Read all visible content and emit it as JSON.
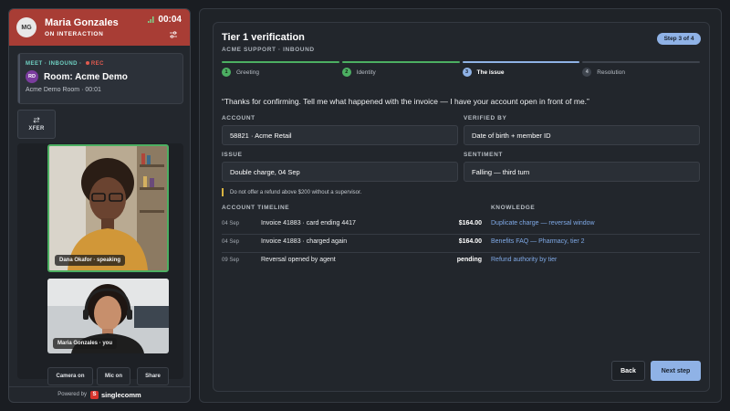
{
  "agent": {
    "initials": "MG",
    "name": "Maria Gonzales",
    "status": "ON INTERACTION",
    "timer": "00:04"
  },
  "call": {
    "meta_left": "MEET · INBOUND ·",
    "rec": "REC",
    "room_initials": "RD",
    "room_title": "Room: Acme Demo",
    "room_sub": "Acme Demo Room · 00:01"
  },
  "xfer": {
    "label": "XFER"
  },
  "video": {
    "participant_label": "Dana Okafor · speaking",
    "self_label": "Maria Gonzales · you"
  },
  "controls": {
    "camera": "Camera on",
    "mic": "Mic on",
    "share": "Share"
  },
  "footer": {
    "powered": "Powered by",
    "brand": "singlecomm"
  },
  "main": {
    "title": "Tier 1 verification",
    "subtitle": "ACME SUPPORT · INBOUND",
    "step_badge": "Step 3 of 4",
    "steps": [
      {
        "num": "1",
        "label": "Greeting",
        "state": "done"
      },
      {
        "num": "2",
        "label": "Identity",
        "state": "done"
      },
      {
        "num": "3",
        "label": "The issue",
        "state": "active"
      },
      {
        "num": "4",
        "label": "Resolution",
        "state": "todo"
      }
    ],
    "quote": "“Thanks for confirming. Tell me what happened with the invoice — I have your account open in front of me.”",
    "fields": {
      "account_label": "ACCOUNT",
      "account_value": "58821 · Acme Retail",
      "verified_label": "VERIFIED BY",
      "verified_value": "Date of birth + member ID",
      "issue_label": "ISSUE",
      "issue_value": "Double charge, 04 Sep",
      "sentiment_label": "SENTIMENT",
      "sentiment_value": "Falling — third turn"
    },
    "warning": "Do not offer a refund above $200 without a supervisor.",
    "timeline_label": "ACCOUNT TIMELINE",
    "knowledge_label": "KNOWLEDGE",
    "timeline": [
      {
        "date": "04 Sep",
        "text": "Invoice 41883 · card ending 4417",
        "amount": "$164.00",
        "link": "Duplicate charge — reversal window"
      },
      {
        "date": "04 Sep",
        "text": "Invoice 41883 · charged again",
        "amount": "$164.00",
        "link": "Benefits FAQ — Pharmacy, tier 2"
      },
      {
        "date": "09 Sep",
        "text": "Reversal opened by agent",
        "amount": "pending",
        "link": "Refund authority by tier"
      }
    ],
    "back_label": "Back",
    "next_label": "Next step"
  },
  "colors": {
    "header_red": "#a83d35",
    "accent_blue": "#8fb2e6",
    "done_green": "#4caf62",
    "link_blue": "#7fa9e6",
    "warning_yellow": "#d8b341"
  }
}
